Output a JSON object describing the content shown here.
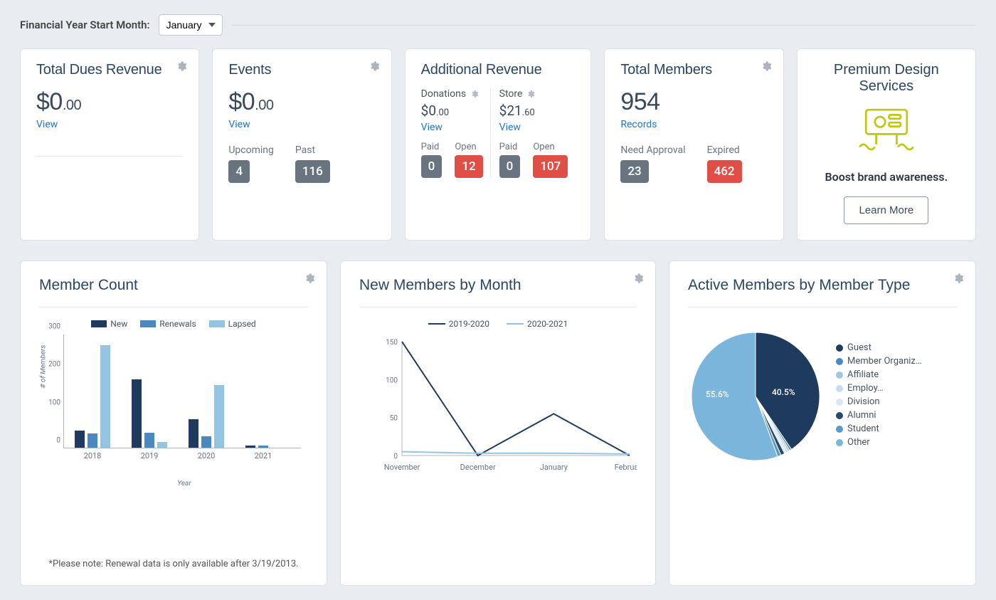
{
  "topbar": {
    "label": "Financial Year Start Month:",
    "selected_month": "January"
  },
  "cards": {
    "dues": {
      "title": "Total Dues Revenue",
      "value_whole": "$0",
      "value_cents": ".00",
      "view": "View"
    },
    "events": {
      "title": "Events",
      "value_whole": "$0",
      "value_cents": ".00",
      "view": "View",
      "upcoming_label": "Upcoming",
      "upcoming_value": "4",
      "past_label": "Past",
      "past_value": "116"
    },
    "addrev": {
      "title": "Additional Revenue",
      "donations": {
        "label": "Donations",
        "value_whole": "$0",
        "value_cents": ".00",
        "view": "View",
        "paid_label": "Paid",
        "paid_value": "0",
        "open_label": "Open",
        "open_value": "12"
      },
      "store": {
        "label": "Store",
        "value_whole": "$21",
        "value_cents": ".60",
        "view": "View",
        "paid_label": "Paid",
        "paid_value": "0",
        "open_label": "Open",
        "open_value": "107"
      }
    },
    "members": {
      "title": "Total Members",
      "value": "954",
      "records": "Records",
      "need_label": "Need Approval",
      "need_value": "23",
      "expired_label": "Expired",
      "expired_value": "462"
    },
    "premium": {
      "title": "Premium Design Services",
      "boost": "Boost brand awareness.",
      "learn_more": "Learn More"
    }
  },
  "charts": {
    "member_count": {
      "title": "Member Count",
      "footnote": "*Please note: Renewal data is only available after 3/19/2013.",
      "legend": {
        "new": "New",
        "renewals": "Renewals",
        "lapsed": "Lapsed"
      },
      "y_label": "# of Members",
      "x_label": "Year"
    },
    "new_members": {
      "title": "New Members by Month",
      "legend": {
        "s1": "2019-2020",
        "s2": "2020-2021"
      }
    },
    "active_by_type": {
      "title": "Active Members by Member Type",
      "legend_items": [
        "Guest",
        "Member Organiz…",
        "Affiliate",
        "Employ…",
        "Division",
        "Alumni",
        "Student",
        "Other"
      ],
      "pct1": "55.6%",
      "pct2": "40.5%"
    }
  },
  "chart_data": [
    {
      "type": "bar",
      "title": "Member Count",
      "categories": [
        "2018",
        "2019",
        "2020",
        "2021"
      ],
      "series": [
        {
          "name": "New",
          "values": [
            45,
            180,
            75,
            5
          ]
        },
        {
          "name": "Renewals",
          "values": [
            38,
            40,
            30,
            5
          ]
        },
        {
          "name": "Lapsed",
          "values": [
            270,
            15,
            165,
            0
          ]
        }
      ],
      "xlabel": "Year",
      "ylabel": "# of Members",
      "ylim": [
        0,
        300
      ]
    },
    {
      "type": "line",
      "title": "New Members by Month",
      "categories": [
        "November",
        "December",
        "January",
        "February"
      ],
      "series": [
        {
          "name": "2019-2020",
          "values": [
            150,
            0,
            55,
            0
          ]
        },
        {
          "name": "2020-2021",
          "values": [
            5,
            3,
            3,
            2
          ]
        }
      ],
      "ylim": [
        0,
        150
      ]
    },
    {
      "type": "pie",
      "title": "Active Members by Member Type",
      "categories": [
        "Guest",
        "Member Organization",
        "Affiliate",
        "Employer",
        "Division",
        "Alumni",
        "Student",
        "Other"
      ],
      "values": [
        40.5,
        0.5,
        0.5,
        0.5,
        0.5,
        1.0,
        0.9,
        55.6
      ],
      "colors": [
        "#1f3a5f",
        "#4a89c0",
        "#a0c7e0",
        "#c4ddee",
        "#d7e8f3",
        "#2a4a6d",
        "#5a9ccf",
        "#7ab5db"
      ]
    }
  ]
}
